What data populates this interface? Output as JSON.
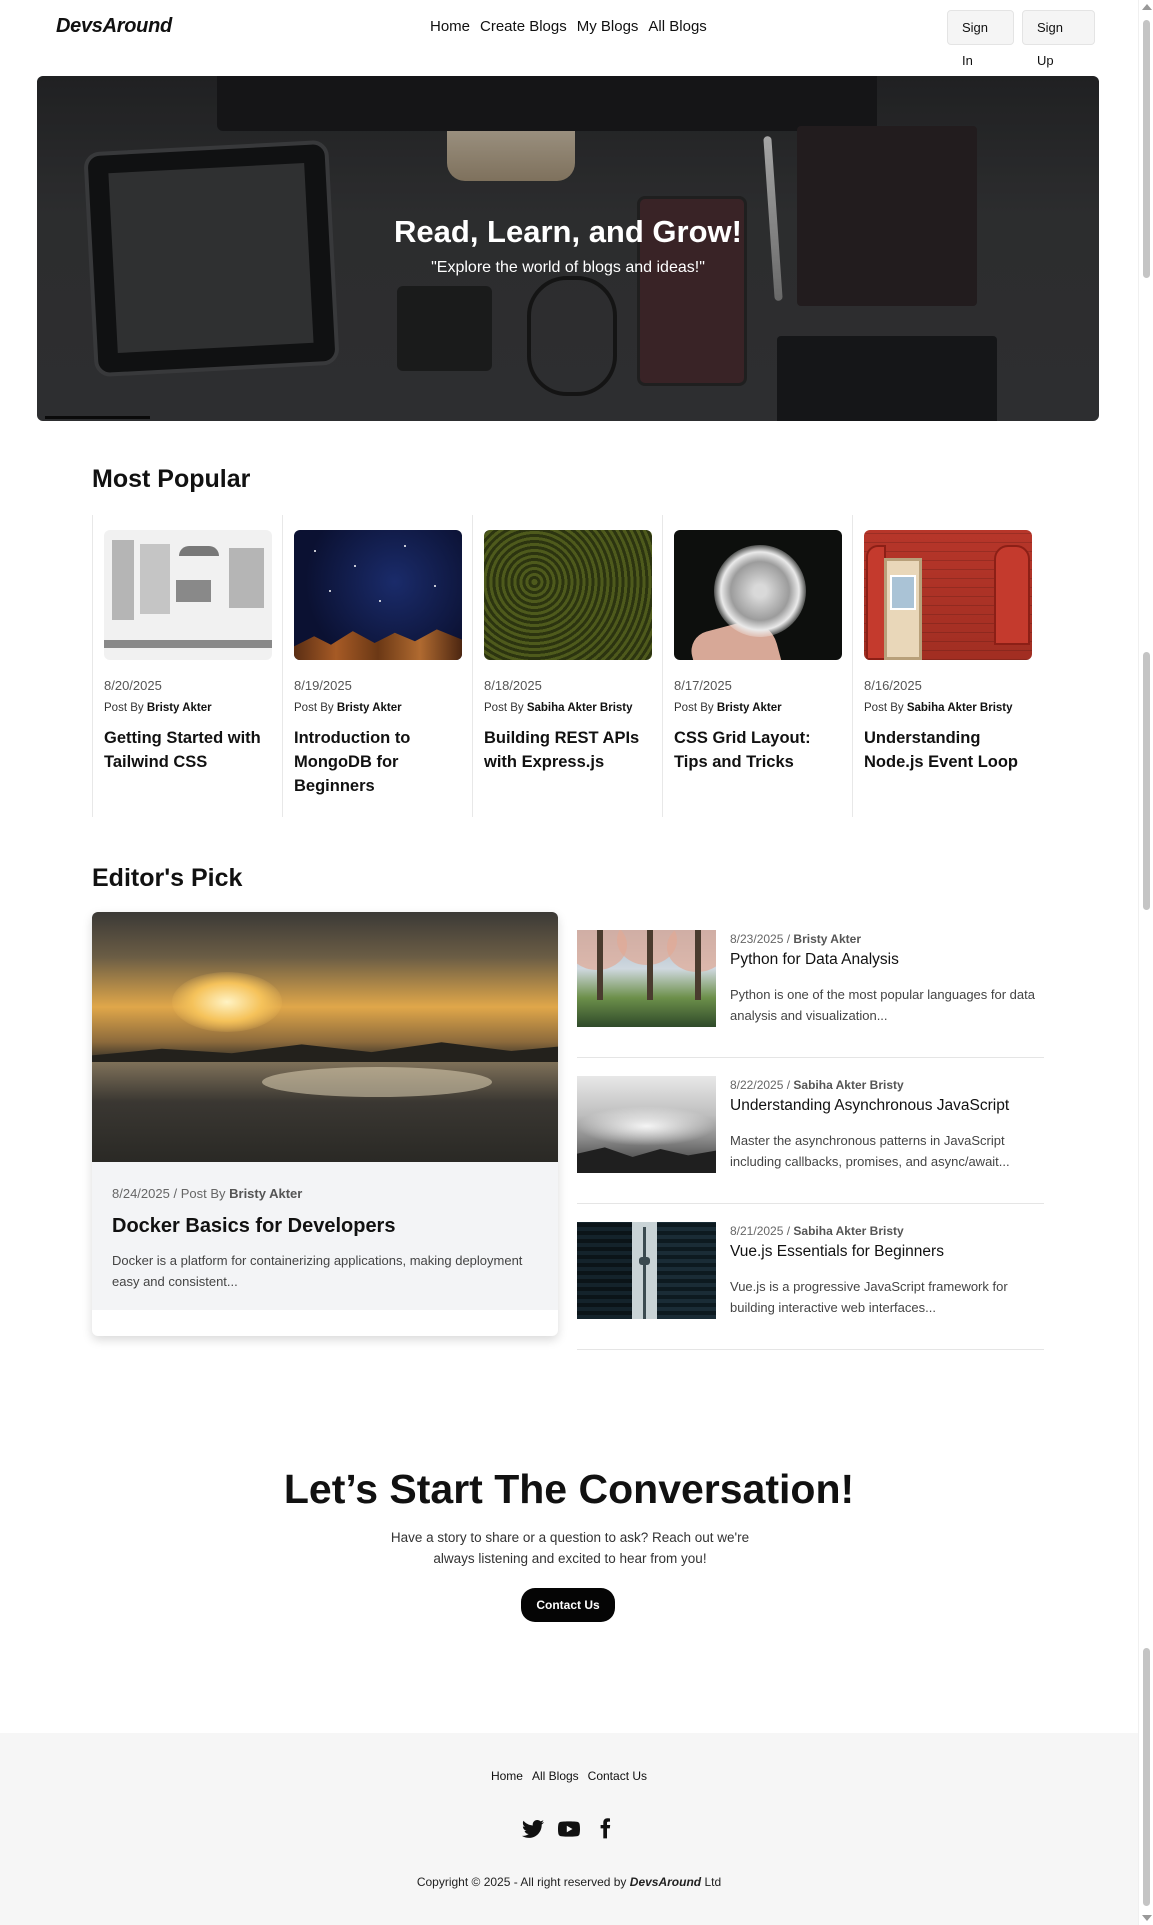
{
  "nav": {
    "logo": "DevsAround",
    "links": [
      "Home",
      "Create Blogs",
      "My Blogs",
      "All Blogs"
    ],
    "sign_in": "Sign In",
    "sign_up": "Sign Up"
  },
  "hero": {
    "title": "Read, Learn, and Grow!",
    "subtitle": "\"Explore the world of blogs and ideas!\""
  },
  "popular": {
    "heading": "Most Popular",
    "post_by": "Post By",
    "cards": [
      {
        "date": "8/20/2025",
        "author": "Bristy Akter",
        "title": "Getting Started with Tailwind CSS"
      },
      {
        "date": "8/19/2025",
        "author": "Bristy Akter",
        "title": "Introduction to MongoDB for Beginners"
      },
      {
        "date": "8/18/2025",
        "author": "Sabiha Akter Bristy",
        "title": "Building REST APIs with Express.js"
      },
      {
        "date": "8/17/2025",
        "author": "Bristy Akter",
        "title": "CSS Grid Layout: Tips and Tricks"
      },
      {
        "date": "8/16/2025",
        "author": "Sabiha Akter Bristy",
        "title": "Understanding Node.js Event Loop"
      }
    ]
  },
  "editors": {
    "heading": "Editor's Pick",
    "featured": {
      "date": "8/24/2025",
      "post_by": "/ Post By",
      "author": "Bristy Akter",
      "title": "Docker Basics for Developers",
      "desc": "Docker is a platform for containerizing applications, making deployment easy and consistent..."
    },
    "items": [
      {
        "date": "8/23/2025 /",
        "author": "Bristy Akter",
        "title": "Python for Data Analysis",
        "desc": "Python is one of the most popular languages for data analysis and visualization..."
      },
      {
        "date": "8/22/2025 /",
        "author": "Sabiha Akter Bristy",
        "title": "Understanding Asynchronous JavaScript",
        "desc": "Master the asynchronous patterns in JavaScript including callbacks, promises, and async/await..."
      },
      {
        "date": "8/21/2025 /",
        "author": "Sabiha Akter Bristy",
        "title": "Vue.js Essentials for Beginners",
        "desc": "Vue.js is a progressive JavaScript framework for building interactive web interfaces..."
      }
    ]
  },
  "cta": {
    "title": "Let’s Start The Conversation!",
    "text": "Have a story to share or a question to ask? Reach out we're always listening and excited to hear from you!",
    "button": "Contact Us"
  },
  "footer": {
    "links": [
      "Home",
      "All Blogs",
      "Contact Us"
    ],
    "icons": [
      "twitter-icon",
      "youtube-icon",
      "facebook-icon"
    ],
    "copy_prefix": "Copyright © 2025 - All right reserved by",
    "copy_brand": "DevsAround",
    "copy_suffix": "Ltd"
  }
}
